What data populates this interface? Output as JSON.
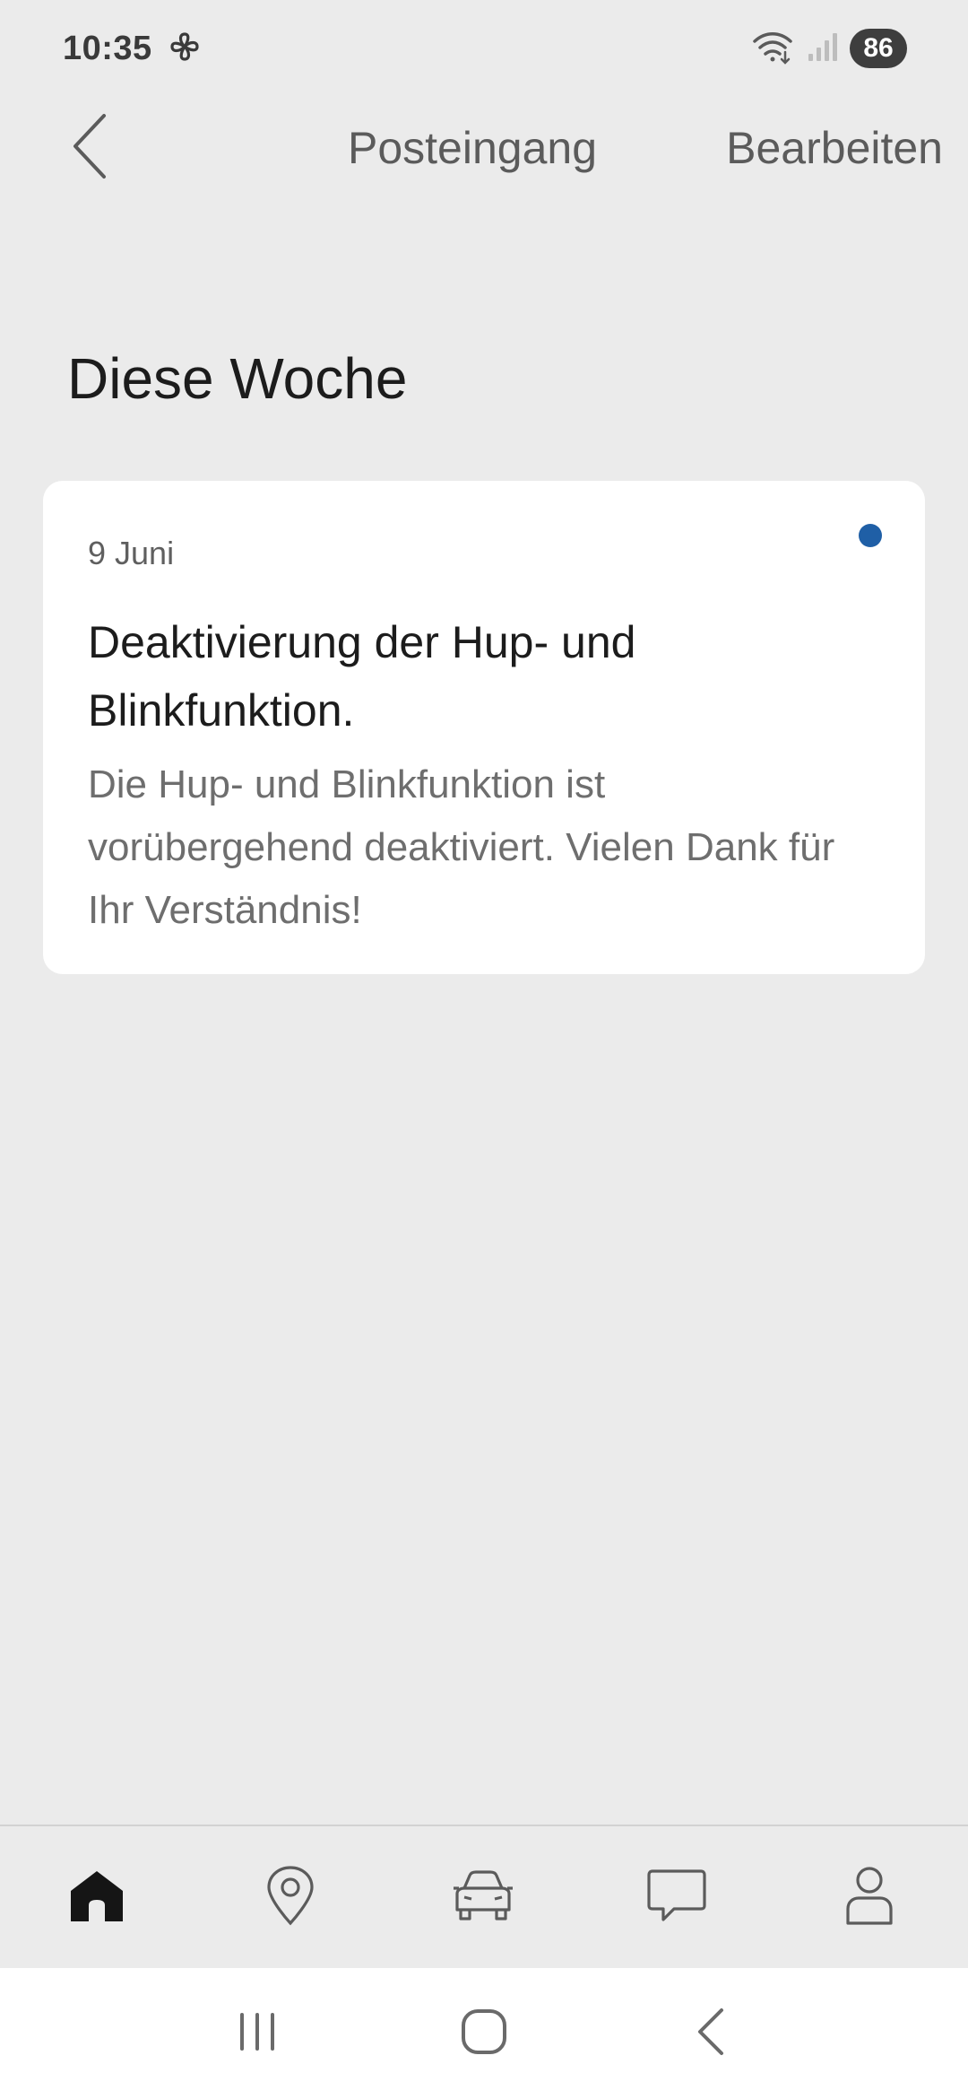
{
  "status_bar": {
    "time": "10:35",
    "battery": "86",
    "icons": [
      "pinwheel-icon",
      "wifi-icon",
      "signal-icon"
    ]
  },
  "header": {
    "title": "Posteingang",
    "edit_label": "Bearbeiten",
    "back_icon": "chevron-left-icon"
  },
  "section": {
    "title": "Diese Woche"
  },
  "messages": [
    {
      "date": "9 Juni",
      "title": "Deaktivierung der Hup- und Blinkfunktion.",
      "body": "Die Hup- und Blinkfunktion ist vorübergehend deaktiviert. Vielen Dank für Ihr Verständnis!",
      "unread": true
    }
  ],
  "tab_bar": {
    "items": [
      "home-icon",
      "map-pin-icon",
      "car-icon",
      "chat-icon",
      "profile-icon"
    ],
    "active": "home-icon"
  },
  "nav_bar": {
    "items": [
      "recents-icon",
      "home-circle-icon",
      "back-icon"
    ]
  },
  "colors": {
    "background": "#ebebeb",
    "card": "#ffffff",
    "unread_dot": "#1f5fa6",
    "muted_text": "#5b5b5b"
  }
}
